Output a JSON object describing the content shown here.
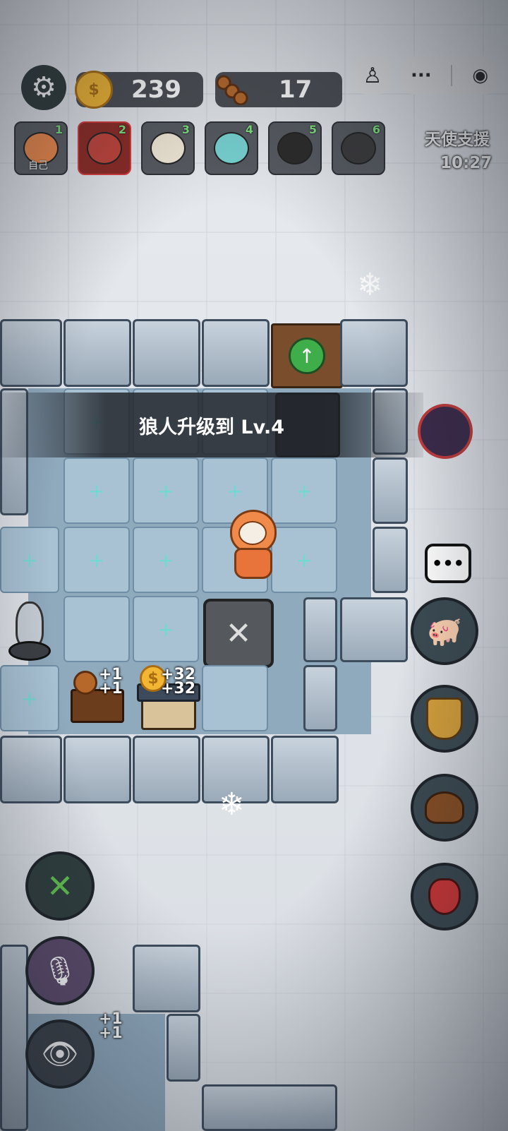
{
  "resources": {
    "gold": "239",
    "wood": "17"
  },
  "players": [
    {
      "num": "1",
      "tag": "自己",
      "color": "#f08a4b"
    },
    {
      "num": "2",
      "tag": "",
      "color": "#c1443a"
    },
    {
      "num": "3",
      "tag": "",
      "color": "#f1e8d6"
    },
    {
      "num": "4",
      "tag": "",
      "color": "#77d3d1"
    },
    {
      "num": "5",
      "tag": "",
      "color": "#2b2b2b"
    },
    {
      "num": "6",
      "tag": "",
      "color": "#3a3a3a"
    }
  ],
  "event": {
    "title": "天使支援",
    "timer": "10:27"
  },
  "banner": "狼人升级到 Lv.4",
  "gains": {
    "wood1": "+1",
    "wood2": "+1",
    "gold1": "+32",
    "gold2": "+32",
    "wood3": "+1",
    "wood4": "+1"
  },
  "colors": {
    "accent_green": "#3fae4a",
    "danger_red": "#d63b3b"
  }
}
